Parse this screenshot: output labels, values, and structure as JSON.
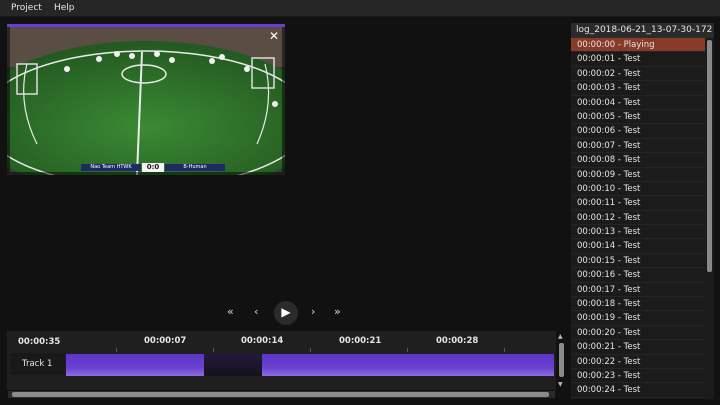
{
  "menu": {
    "items": [
      "Project",
      "Help"
    ]
  },
  "video": {
    "close_glyph": "✕",
    "scoreboard": {
      "left_team": "Nao Team HTWK",
      "score": "0:0",
      "right_team": "B-Human"
    }
  },
  "controls": {
    "skip_back": "«",
    "step_back": "‹",
    "play": "▶",
    "step_forward": "›",
    "skip_forward": "»"
  },
  "timeline": {
    "current_time": "00:00:35",
    "ticks": [
      "00:00:07",
      "00:00:14",
      "00:00:21",
      "00:00:28"
    ],
    "track_label": "Track 1"
  },
  "log": {
    "title": "log_2018-06-21_13-07-30-172",
    "items": [
      "00:00:00 - Playing",
      "00:00:01 - Test",
      "00:00:02 - Test",
      "00:00:03 - Test",
      "00:00:04 - Test",
      "00:00:05 - Test",
      "00:00:06 - Test",
      "00:00:07 - Test",
      "00:00:08 - Test",
      "00:00:09 - Test",
      "00:00:10 - Test",
      "00:00:11 - Test",
      "00:00:12 - Test",
      "00:00:13 - Test",
      "00:00:14 - Test",
      "00:00:15 - Test",
      "00:00:16 - Test",
      "00:00:17 - Test",
      "00:00:18 - Test",
      "00:00:19 - Test",
      "00:00:20 - Test",
      "00:00:21 - Test",
      "00:00:22 - Test",
      "00:00:23 - Test",
      "00:00:24 - Test"
    ],
    "active_index": 0
  },
  "colors": {
    "accent": "#6a3fd0",
    "active_row": "#8a3a28",
    "field": "#2f6e2b"
  }
}
